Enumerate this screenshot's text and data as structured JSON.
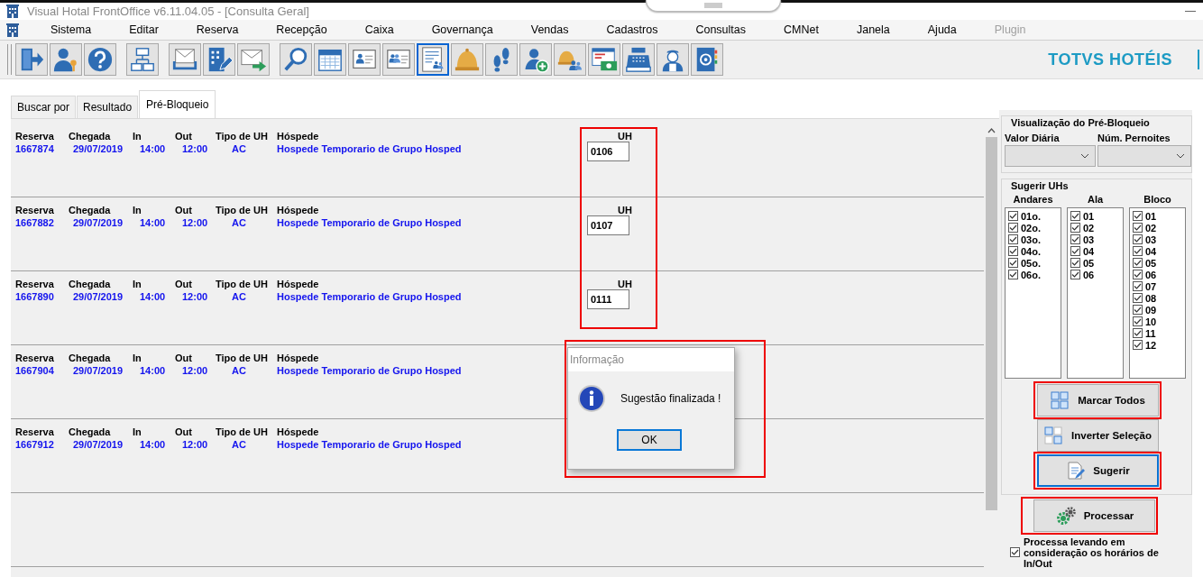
{
  "window": {
    "title": "Visual Hotal FrontOffice v6.11.04.05 - [Consulta Geral]"
  },
  "menu": [
    {
      "label": "Sistema",
      "disabled": false
    },
    {
      "label": "Editar",
      "disabled": false
    },
    {
      "label": "Reserva",
      "disabled": false
    },
    {
      "label": "Recepção",
      "disabled": false
    },
    {
      "label": "Caixa",
      "disabled": false
    },
    {
      "label": "Governança",
      "disabled": false
    },
    {
      "label": "Vendas",
      "disabled": false
    },
    {
      "label": "Cadastros",
      "disabled": false
    },
    {
      "label": "Consultas",
      "disabled": false
    },
    {
      "label": "CMNet",
      "disabled": false
    },
    {
      "label": "Janela",
      "disabled": false
    },
    {
      "label": "Ajuda",
      "disabled": false
    },
    {
      "label": "Plugin",
      "disabled": true
    }
  ],
  "toolbar": [
    {
      "selected": false
    },
    {
      "selected": false
    },
    {
      "selected": false
    },
    {
      "selected": false
    },
    {
      "selected": false
    },
    {
      "selected": false
    },
    {
      "selected": false
    },
    {
      "selected": false
    },
    {
      "selected": false
    },
    {
      "selected": false
    },
    {
      "selected": false
    },
    {
      "selected": true
    },
    {
      "selected": false
    },
    {
      "selected": false
    },
    {
      "selected": false
    },
    {
      "selected": false
    },
    {
      "selected": false
    },
    {
      "selected": false
    },
    {
      "selected": false
    },
    {
      "selected": false
    }
  ],
  "brand": "TOTVS HOTÉIS",
  "tabs": [
    {
      "label": "Buscar por",
      "selected": false
    },
    {
      "label": "Resultado",
      "selected": false
    },
    {
      "label": "Pré-Bloqueio",
      "selected": true
    }
  ],
  "rows": [
    {
      "labels": [
        "Reserva",
        "Chegada",
        "In",
        "Out",
        "Tipo de UH",
        "Hóspede"
      ],
      "cells": [
        "1667874",
        "29/07/2019",
        "14:00",
        "12:00",
        "AC",
        "Hospede Temporario de Grupo Hosped"
      ],
      "uh": {
        "label": "UH",
        "value": "0106",
        "highlighted": true
      }
    },
    {
      "labels": [
        "Reserva",
        "Chegada",
        "In",
        "Out",
        "Tipo de UH",
        "Hóspede"
      ],
      "cells": [
        "1667882",
        "29/07/2019",
        "14:00",
        "12:00",
        "AC",
        "Hospede Temporario de Grupo Hosped"
      ],
      "uh": {
        "label": "UH",
        "value": "0107",
        "highlighted": true
      }
    },
    {
      "labels": [
        "Reserva",
        "Chegada",
        "In",
        "Out",
        "Tipo de UH",
        "Hóspede"
      ],
      "cells": [
        "1667890",
        "29/07/2019",
        "14:00",
        "12:00",
        "AC",
        "Hospede Temporario de Grupo Hosped"
      ],
      "uh": {
        "label": "UH",
        "value": "0111",
        "highlighted": true
      }
    },
    {
      "labels": [
        "Reserva",
        "Chegada",
        "In",
        "Out",
        "Tipo de UH",
        "Hóspede"
      ],
      "cells": [
        "1667904",
        "29/07/2019",
        "14:00",
        "12:00",
        "AC",
        "Hospede Temporario de Grupo Hosped"
      ]
    },
    {
      "labels": [
        "Reserva",
        "Chegada",
        "In",
        "Out",
        "Tipo de UH",
        "Hóspede"
      ],
      "cells": [
        "1667912",
        "29/07/2019",
        "14:00",
        "12:00",
        "AC",
        "Hospede Temporario de Grupo Hosped"
      ]
    }
  ],
  "preview": {
    "title": "Visualização do Pré-Bloqueio",
    "fields": [
      {
        "label": "Valor Diária"
      },
      {
        "label": "Núm. Pernoites"
      }
    ]
  },
  "suggest": {
    "title": "Sugerir UHs",
    "lists": [
      {
        "title": "Andares",
        "items": [
          {
            "label": "01o.",
            "checked": true
          },
          {
            "label": "02o.",
            "checked": true
          },
          {
            "label": "03o.",
            "checked": true
          },
          {
            "label": "04o.",
            "checked": true
          },
          {
            "label": "05o.",
            "checked": true
          },
          {
            "label": "06o.",
            "checked": true
          }
        ]
      },
      {
        "title": "Ala",
        "items": [
          {
            "label": "01",
            "checked": true
          },
          {
            "label": "02",
            "checked": true
          },
          {
            "label": "03",
            "checked": true
          },
          {
            "label": "04",
            "checked": true
          },
          {
            "label": "05",
            "checked": true
          },
          {
            "label": "06",
            "checked": true
          }
        ]
      },
      {
        "title": "Bloco",
        "items": [
          {
            "label": "01",
            "checked": true
          },
          {
            "label": "02",
            "checked": true
          },
          {
            "label": "03",
            "checked": true
          },
          {
            "label": "04",
            "checked": true
          },
          {
            "label": "05",
            "checked": true
          },
          {
            "label": "06",
            "checked": true
          },
          {
            "label": "07",
            "checked": true
          },
          {
            "label": "08",
            "checked": true
          },
          {
            "label": "09",
            "checked": true
          },
          {
            "label": "10",
            "checked": true
          },
          {
            "label": "11",
            "checked": true
          },
          {
            "label": "12",
            "checked": true
          }
        ]
      }
    ]
  },
  "buttons": [
    {
      "kind": "mark-all",
      "label": "Marcar Todos",
      "highlighted": true,
      "focused": false
    },
    {
      "kind": "invert",
      "label": "Inverter Seleção",
      "highlighted": false,
      "focused": false
    },
    {
      "kind": "suggest",
      "label": "Sugerir",
      "highlighted": true,
      "focused": true
    }
  ],
  "process_button": {
    "label": "Processar",
    "highlighted": true
  },
  "process_option": {
    "label": "Processa levando em consideração os horários de In/Out",
    "checked": true
  },
  "dialog": {
    "title": "Informação",
    "message": "Sugestão finalizada !",
    "button": "OK",
    "highlighted": true
  }
}
